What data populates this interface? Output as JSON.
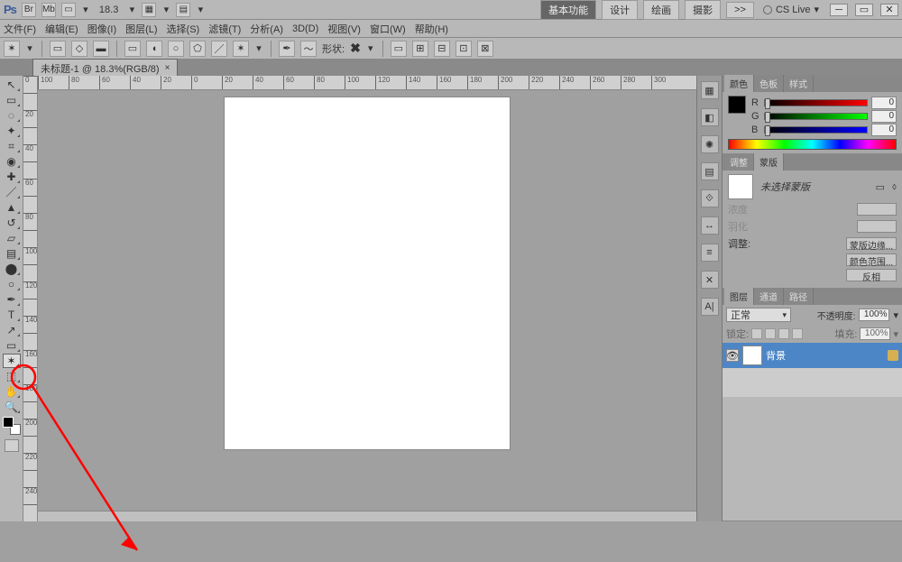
{
  "top": {
    "logo": "Ps",
    "zoom": "18.3",
    "tabs": {
      "essentials": "基本功能",
      "design": "设计",
      "paint": "绘画",
      "photo": "摄影",
      "more": ">>"
    },
    "cslive": "CS Live"
  },
  "menu": {
    "file": "文件(F)",
    "edit": "编辑(E)",
    "image": "图像(I)",
    "layer": "图层(L)",
    "select": "选择(S)",
    "filter": "滤镜(T)",
    "analysis": "分析(A)",
    "three_d": "3D(D)",
    "view": "视图(V)",
    "window": "窗口(W)",
    "help": "帮助(H)"
  },
  "opts": {
    "shape_label": "形状:"
  },
  "doc": {
    "title": "未标题-1 @ 18.3%(RGB/8)",
    "close": "×"
  },
  "tools": [
    {
      "n": "move",
      "g": "↖"
    },
    {
      "n": "marquee",
      "g": "▭"
    },
    {
      "n": "lasso",
      "g": "◌"
    },
    {
      "n": "magic-wand",
      "g": "✦"
    },
    {
      "n": "crop",
      "g": "⌗"
    },
    {
      "n": "eyedropper",
      "g": "◉"
    },
    {
      "n": "healing",
      "g": "✚"
    },
    {
      "n": "brush",
      "g": "／"
    },
    {
      "n": "stamp",
      "g": "▲"
    },
    {
      "n": "history-brush",
      "g": "↺"
    },
    {
      "n": "eraser",
      "g": "▱"
    },
    {
      "n": "gradient",
      "g": "▤"
    },
    {
      "n": "blur",
      "g": "⬤"
    },
    {
      "n": "dodge",
      "g": "○"
    },
    {
      "n": "pen",
      "g": "✒"
    },
    {
      "n": "type",
      "g": "T"
    },
    {
      "n": "path-select",
      "g": "↗"
    },
    {
      "n": "shape",
      "g": "▭"
    },
    {
      "n": "custom-shape",
      "g": "✶"
    },
    {
      "n": "3d",
      "g": "⬚"
    },
    {
      "n": "hand",
      "g": "✋"
    },
    {
      "n": "zoom",
      "g": "🔍"
    }
  ],
  "ruler_marks_h": [
    "100",
    "80",
    "60",
    "40",
    "20",
    "0",
    "20",
    "40",
    "60",
    "80",
    "100",
    "120",
    "140",
    "160",
    "180",
    "200",
    "220",
    "240",
    "260",
    "280",
    "300"
  ],
  "ruler_marks_v": [
    "0",
    "2",
    "0",
    "4",
    "0",
    "6",
    "0",
    "8",
    "0",
    "1",
    "0",
    "0",
    "1",
    "2",
    "0",
    "1",
    "4",
    "0",
    "1",
    "6",
    "0",
    "1",
    "8",
    "0"
  ],
  "panels": {
    "color": {
      "tabs": {
        "color": "颜色",
        "swatches": "色板",
        "styles": "样式"
      },
      "r": "R",
      "g": "G",
      "b": "B",
      "rv": "0",
      "gv": "0",
      "bv": "0"
    },
    "adjust": {
      "tabs": {
        "adjust": "调整",
        "mask": "蒙版"
      },
      "no_mask": "未选择蒙版",
      "density": "浓度",
      "feather": "羽化",
      "refine": "调整:",
      "btns": {
        "edge": "蒙版边缘...",
        "color": "颜色范围...",
        "invert": "反相"
      }
    },
    "layers": {
      "tabs": {
        "layers": "图层",
        "channels": "通道",
        "paths": "路径"
      },
      "blend": "正常",
      "opacity_lbl": "不透明度:",
      "opacity": "100%",
      "lock_lbl": "锁定:",
      "fill_lbl": "填充:",
      "fill": "100%",
      "bg_layer": "背景"
    }
  },
  "dock_icons": [
    "▦",
    "◧",
    "✺",
    "▤",
    "⟐",
    "↔",
    "≡",
    "✕",
    "A|"
  ]
}
